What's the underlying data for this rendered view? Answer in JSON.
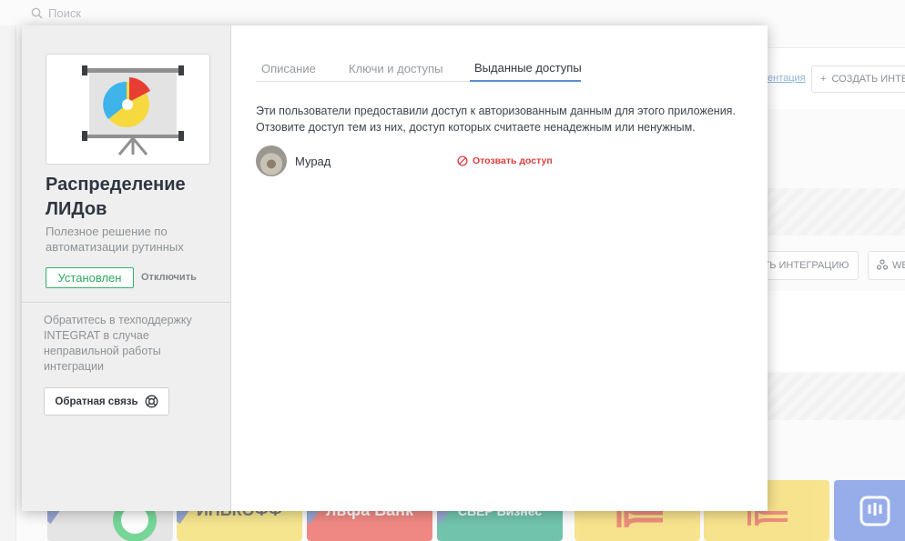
{
  "background": {
    "search_placeholder": "Поиск",
    "doc_link": "ентация",
    "create_button": "СОЗДАТЬ ИНТЕ",
    "integration_button": "ТЬ ИНТЕГРАЦИЮ",
    "web_button": "WE",
    "tiles": [
      "",
      "ИНЬКОФФ",
      "льфа Банк",
      "СБЕР Бизнес",
      "",
      "",
      ""
    ]
  },
  "modal": {
    "sidebar": {
      "app_title": "Распределение ЛИДов",
      "app_description": "Полезное решение по автоматизации рутинных",
      "status_badge": "Установлен",
      "disable_link": "Отключить",
      "support_text": "Обратитесь в техподдержку INTEGRAT в случае неправильной работы интеграции",
      "feedback_button": "Обратная связь"
    },
    "tabs": [
      {
        "label": "Описание",
        "active": false
      },
      {
        "label": "Ключи и доступы",
        "active": false
      },
      {
        "label": "Выданные доступы",
        "active": true
      }
    ],
    "info_text": "Эти пользователи предоставили доступ к авторизованным данным для этого приложения. Отзовите доступ тем из них, доступ которых считаете ненадежным или ненужным.",
    "users": [
      {
        "name": "Мурад",
        "action": "Отозвать доступ"
      }
    ]
  },
  "colors": {
    "accent_green": "#2fb565",
    "tab_active_underline": "#5c8fd2",
    "revoke_red": "#de3d3d",
    "sidebar_bg": "#efefef"
  },
  "icons": [
    "search-icon",
    "plus-icon",
    "webhook-icon",
    "presentation-board-icon",
    "lifebuoy-icon",
    "block-icon"
  ]
}
